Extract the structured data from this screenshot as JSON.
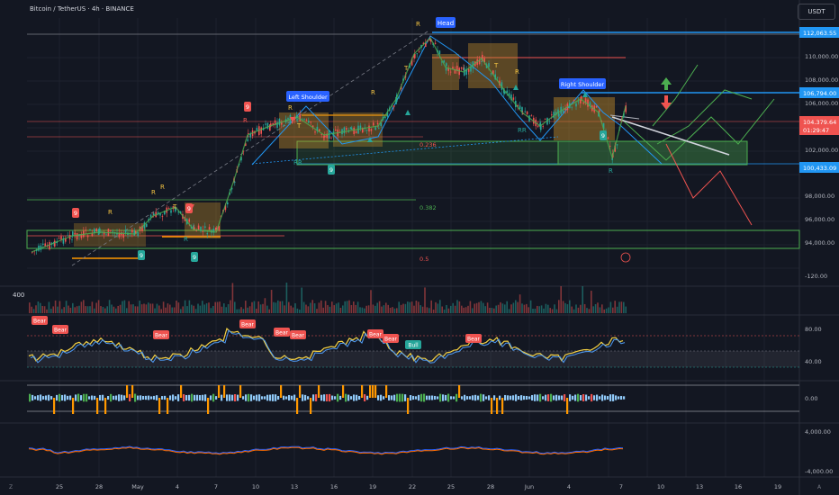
{
  "header": {
    "symbol_title": "Bitcoin / TetherUS · 4h · BINANCE",
    "currency": "USDT"
  },
  "colors": {
    "background": "#131722",
    "up": "#26a69a",
    "down": "#ef5350",
    "head_line": "#2196f3",
    "box": "#c8912a",
    "fib_green": "#4caf50",
    "fib_red": "#f23645",
    "rsi_yellow": "#f5d142",
    "rsi_blue": "#4e9bf5"
  },
  "price_axis": {
    "ticks": [
      "110,000.00",
      "108,000.00",
      "106,000.00",
      "102,000.00",
      "98,000.00",
      "96,000.00",
      "94,000.00",
      "-120.00"
    ],
    "price_tags": [
      {
        "label": "112,063.55",
        "color": "#2196f3"
      },
      {
        "label": "106,794.00",
        "color": "#2196f3"
      },
      {
        "label": "104,379.64",
        "color": "#ef5350"
      },
      {
        "label": "01:29:47",
        "color": "#ef5350"
      },
      {
        "label": "100,433.09",
        "color": "#2196f3"
      }
    ]
  },
  "time_axis": {
    "ticks": [
      "25",
      "28",
      "May",
      "4",
      "7",
      "10",
      "13",
      "16",
      "19",
      "22",
      "25",
      "28",
      "Jun",
      "4",
      "7",
      "10",
      "13",
      "16",
      "19"
    ]
  },
  "pattern_labels": {
    "head": "Head",
    "left_shoulder": "Left Shoulder",
    "right_shoulder": "Right Shoulder",
    "fib_382": "0.382",
    "fib_5": "0.5",
    "fib_236": "0.236"
  },
  "markers": {
    "nine": "9",
    "r": "R",
    "rr": "RR",
    "t": "T"
  },
  "volume_pane": {
    "label": "400"
  },
  "rsi_pane": {
    "ticks": [
      "80.00",
      "40.00"
    ],
    "labels": [
      "Bear",
      "Bear",
      "Bear",
      "Bear",
      "Bear",
      "Bear",
      "Bear",
      "Bear",
      "Bull",
      "Bear"
    ]
  },
  "osc_pane": {
    "ticks": [
      "0.00"
    ]
  },
  "macd_pane": {
    "ticks": [
      "4,000.00",
      "-4,000.00"
    ]
  },
  "footer": {
    "left": "Z",
    "right": "A"
  }
}
